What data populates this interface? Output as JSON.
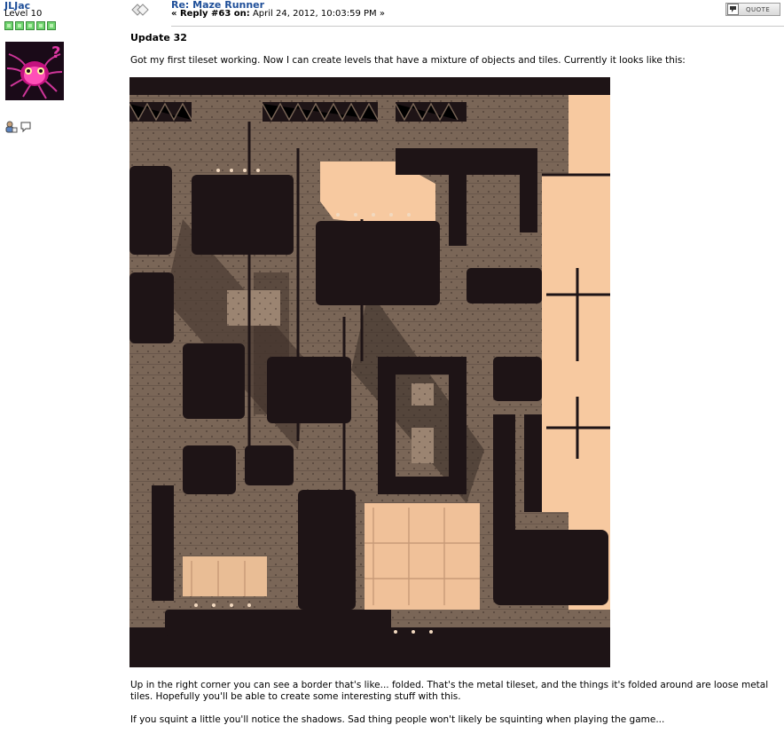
{
  "poster": {
    "name": "JLJac",
    "level": "Level 10",
    "star_count": 5
  },
  "post": {
    "title": "Re: Maze Runner",
    "reply_prefix": "« Reply #63 on:",
    "date": "April 24, 2012, 10:03:59 PM »",
    "quote_label": "QUOTE"
  },
  "content": {
    "heading": "Update 32",
    "intro": "Got my first tileset working. Now I can create levels that have a mixture of objects and tiles. Currently it looks like this:",
    "para2": "Up in the right corner you can see a border that's like... folded. That's the metal tileset, and the things it's folded around are loose metal tiles. Hopefully you'll be able to create some interesting stuff with this.",
    "para3": "If you squint a little you'll notice the shadows. Sad thing people won't likely be squinting when playing the game..."
  },
  "colors": {
    "link_blue": "#1f4f99",
    "tile_dark": "#1e1416",
    "tile_mid": "#4a3b32",
    "tile_stone": "#7a6657",
    "tile_light": "#f7c9a0",
    "tile_shadow": "#3b2e28"
  }
}
